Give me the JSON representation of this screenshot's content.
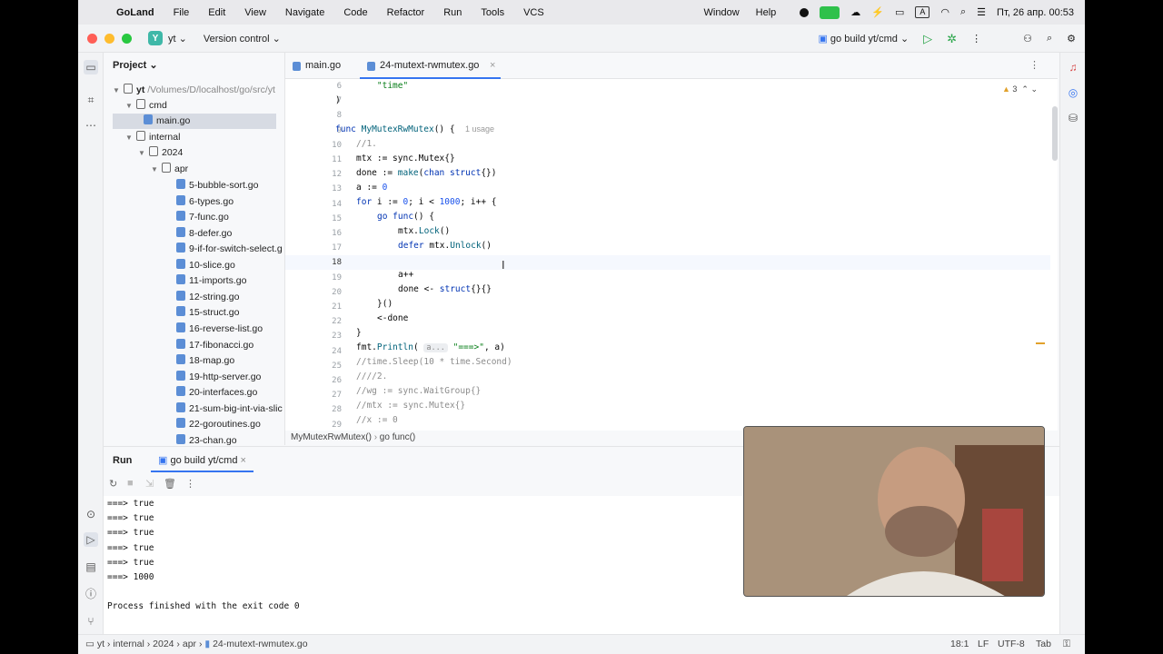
{
  "menubar": {
    "app": "GoLand",
    "items": [
      "File",
      "Edit",
      "View",
      "Navigate",
      "Code",
      "Refactor",
      "Run",
      "Tools",
      "VCS",
      "Window",
      "Help"
    ],
    "input_indicator": "A",
    "datetime": "Пт, 26 апр. 00:53"
  },
  "titlebar": {
    "project_badge": "Y",
    "project": "yt",
    "vcs": "Version control",
    "run_config": "go build yt/cmd"
  },
  "project_panel": {
    "title": "Project",
    "rows": [
      {
        "label": "yt",
        "extra": "/Volumes/D/localhost/go/src/yt"
      },
      {
        "label": "cmd"
      },
      {
        "label": "main.go"
      },
      {
        "label": "internal"
      },
      {
        "label": "2024"
      },
      {
        "label": "apr"
      },
      {
        "label": "5-bubble-sort.go"
      },
      {
        "label": "6-types.go"
      },
      {
        "label": "7-func.go"
      },
      {
        "label": "8-defer.go"
      },
      {
        "label": "9-if-for-switch-select.g"
      },
      {
        "label": "10-slice.go"
      },
      {
        "label": "11-imports.go"
      },
      {
        "label": "12-string.go"
      },
      {
        "label": "15-struct.go"
      },
      {
        "label": "16-reverse-list.go"
      },
      {
        "label": "17-fibonacci.go"
      },
      {
        "label": "18-map.go"
      },
      {
        "label": "19-http-server.go"
      },
      {
        "label": "20-interfaces.go"
      },
      {
        "label": "21-sum-big-int-via-slic"
      },
      {
        "label": "22-goroutines.go"
      },
      {
        "label": "23-chan.go"
      }
    ]
  },
  "tabs": [
    {
      "label": "main.go"
    },
    {
      "label": "24-mutext-rwmutex.go"
    }
  ],
  "editor": {
    "warnings": "3",
    "usage_hint": "1 usage",
    "param_hint": "a...",
    "line_numbers": [
      "6",
      "7",
      "8",
      "9",
      "10",
      "11",
      "12",
      "13",
      "14",
      "15",
      "16",
      "17",
      "18",
      "19",
      "20",
      "21",
      "22",
      "23",
      "24",
      "25",
      "26",
      "27",
      "28",
      "29"
    ]
  },
  "breadcrumb": {
    "func": "MyMutexRwMutex()",
    "inner": "go func()"
  },
  "run_panel": {
    "title": "Run",
    "tab": "go build yt/cmd",
    "output": [
      "===> true",
      "===> true",
      "===> true",
      "===> true",
      "===> true",
      "===> 1000",
      "",
      "Process finished with the exit code 0"
    ]
  },
  "statusbar": {
    "path": [
      "yt",
      "internal",
      "2024",
      "apr",
      "24-mutext-rwmutex.go"
    ],
    "position": "18:1",
    "line_sep": "LF",
    "encoding": "UTF-8",
    "indent": "Tab"
  }
}
